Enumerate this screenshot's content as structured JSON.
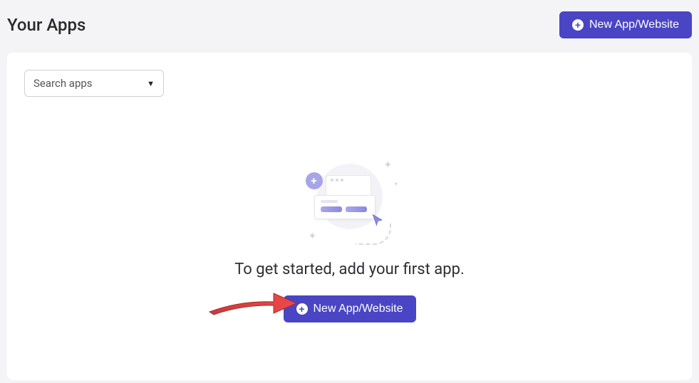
{
  "header": {
    "title": "Your Apps",
    "new_button_label": "New App/Website"
  },
  "search": {
    "placeholder": "Search apps"
  },
  "empty_state": {
    "title": "To get started, add your first app.",
    "cta_label": "New App/Website"
  }
}
